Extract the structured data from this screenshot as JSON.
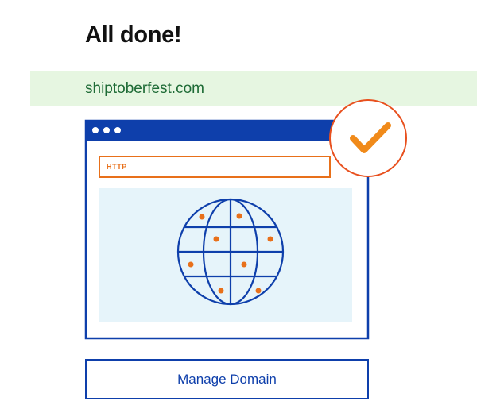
{
  "header": {
    "title": "All done!"
  },
  "domain": {
    "name": "shiptoberfest.com"
  },
  "illustration": {
    "address_bar_text": "HTTP",
    "icons": [
      "browser-window-icon",
      "globe-icon",
      "checkmark-icon"
    ]
  },
  "actions": {
    "manage_label": "Manage Domain"
  },
  "colors": {
    "brand_blue": "#0e3fab",
    "accent_orange": "#e8701a",
    "banner_green": "#e6f6e1",
    "domain_text_green": "#1e6b36",
    "panel_light_blue": "#e6f4fa"
  }
}
